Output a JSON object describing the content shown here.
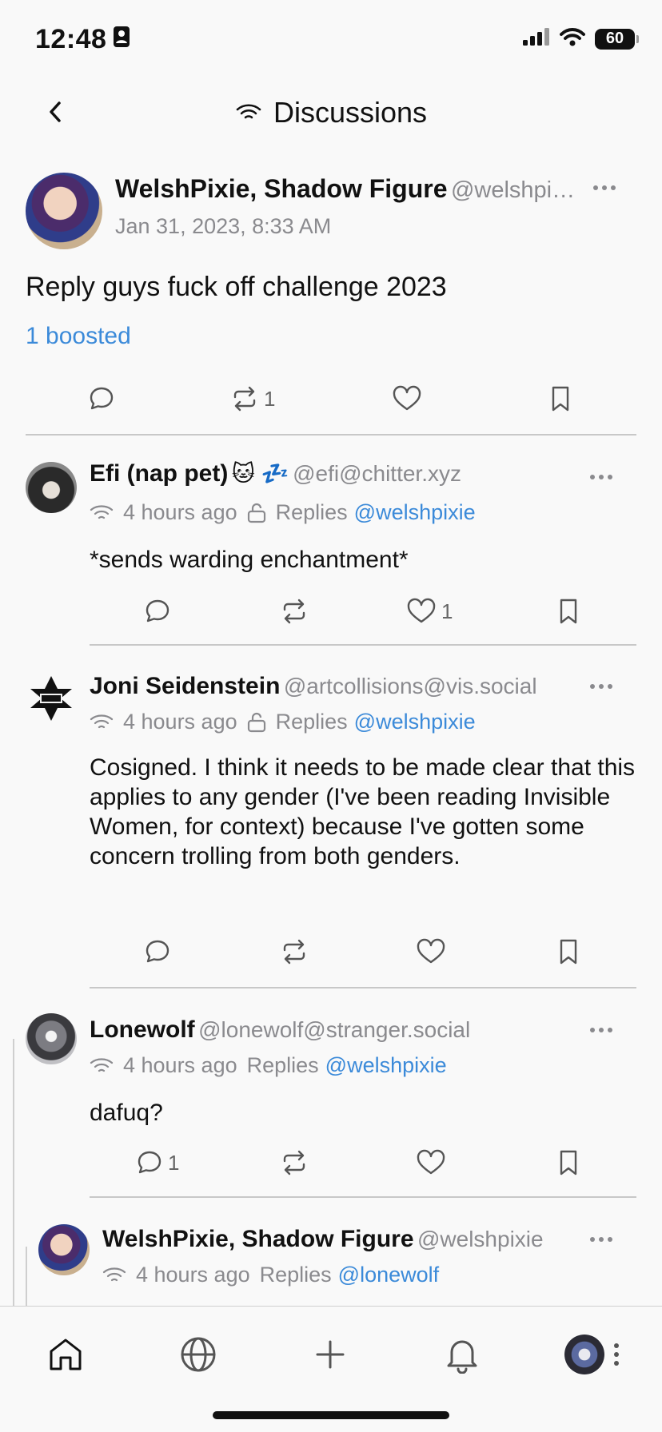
{
  "status_bar": {
    "time": "12:48",
    "battery": "60"
  },
  "nav": {
    "title": "Discussions"
  },
  "main_post": {
    "author": "WelshPixie, Shadow Figure",
    "handle": "@welshpi…",
    "date": "Jan 31, 2023, 8:33 AM",
    "text": "Reply guys fuck off challenge 2023",
    "boosted": "1 boosted",
    "boost_count": "1"
  },
  "replies": [
    {
      "author": "Efi (nap pet)",
      "emoji": "🐱 💤",
      "handle": "@efi@chitter.xyz",
      "time": "4 hours ago",
      "replies_label": "Replies",
      "replies_to": "@welshpixie",
      "text": "*sends warding enchantment*",
      "reply_count": "",
      "like_count": "1"
    },
    {
      "author": "Joni Seidenstein",
      "handle": "@artcollisions@vis.social",
      "time": "4 hours ago",
      "replies_label": "Replies",
      "replies_to": "@welshpixie",
      "text": "Cosigned. I think it needs to be made clear that this applies to any gender (I've been reading Invisible Women, for context) because I've gotten some concern trolling from both genders.",
      "reply_count": "",
      "like_count": ""
    },
    {
      "author": "Lonewolf",
      "handle": "@lonewolf@stranger.social",
      "time": "4 hours ago",
      "replies_label": "Replies",
      "replies_to": "@welshpixie",
      "text": "dafuq?",
      "reply_count": "1",
      "like_count": ""
    },
    {
      "author": "WelshPixie, Shadow Figure",
      "handle": "@welshpixie",
      "time": "4 hours ago",
      "replies_label": "Replies",
      "replies_to": "@lonewolf"
    }
  ],
  "colors": {
    "link": "#3b8ad9",
    "muted": "#8a8a8e",
    "background": "#f9f9f9"
  },
  "tabs": [
    "home-icon",
    "globe-icon",
    "compose-icon",
    "bell-icon",
    "profile-avatar"
  ]
}
